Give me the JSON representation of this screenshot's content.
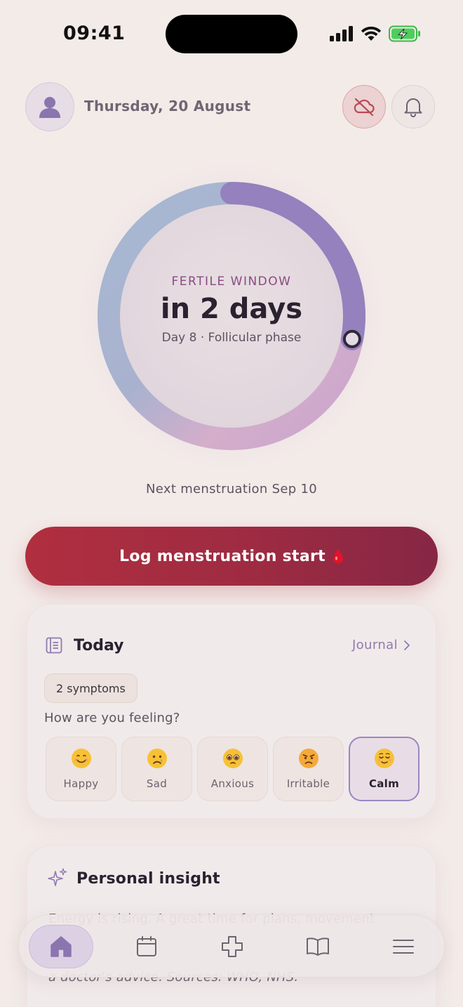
{
  "status_bar": {
    "time": "09:41"
  },
  "header": {
    "date": "Thursday, 20 August"
  },
  "cycle": {
    "phase_label": "FERTILE WINDOW",
    "countdown": "in 2 days",
    "day_info": "Day 8 · Follicular phase",
    "progress_fraction": 0.28,
    "next_menstruation": "Next menstruation Sep 10"
  },
  "log_button": {
    "label": "Log menstruation start"
  },
  "today": {
    "title": "Today",
    "journal_link": "Journal",
    "symptom_chip": "2 symptoms",
    "question": "How are you feeling?",
    "moods": [
      {
        "label": "Happy",
        "icon": "smiling-face-icon",
        "selected": false
      },
      {
        "label": "Sad",
        "icon": "crying-face-icon",
        "selected": false
      },
      {
        "label": "Anxious",
        "icon": "pleading-face-icon",
        "selected": false
      },
      {
        "label": "Irritable",
        "icon": "angry-face-icon",
        "selected": false
      },
      {
        "label": "Calm",
        "icon": "relieved-face-icon",
        "selected": true
      }
    ]
  },
  "insight": {
    "title": "Personal insight",
    "text": "Energy is rising. A great time for plans, movement",
    "footer": "a doctor's advice. Sources: WHO, NHS."
  },
  "nav": {
    "items": [
      {
        "icon": "home-icon",
        "active": true
      },
      {
        "icon": "calendar-icon",
        "active": false
      },
      {
        "icon": "plus-cross-icon",
        "active": false
      },
      {
        "icon": "book-icon",
        "active": false
      },
      {
        "icon": "menu-icon",
        "active": false
      }
    ]
  },
  "colors": {
    "background": "#f3ebe8",
    "accent": "#8e7bb0",
    "log_button": "#a32c41",
    "ring_purple": "#9481bd",
    "ring_blue": "#a4b4cf",
    "ring_pink": "#d3a9c8"
  }
}
